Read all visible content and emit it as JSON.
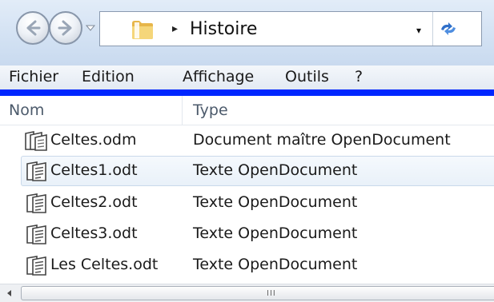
{
  "address": {
    "path_segment": "Histoire",
    "separator": "▸",
    "dropdown_glyph": "▾"
  },
  "menu": {
    "items": [
      "Fichier",
      "Edition",
      "Affichage",
      "Outils",
      "?"
    ]
  },
  "columns": {
    "name": "Nom",
    "type": "Type"
  },
  "files": [
    {
      "name": "Celtes.odm",
      "type": "Document maître OpenDocument",
      "icon": "odm-master-document-icon",
      "selected": false
    },
    {
      "name": "Celtes1.odt",
      "type": "Texte OpenDocument",
      "icon": "odt-text-document-icon",
      "selected": true
    },
    {
      "name": "Celtes2.odt",
      "type": "Texte OpenDocument",
      "icon": "odt-text-document-icon",
      "selected": false
    },
    {
      "name": "Celtes3.odt",
      "type": "Texte OpenDocument",
      "icon": "odt-text-document-icon",
      "selected": false
    },
    {
      "name": "Les Celtes.odt",
      "type": "Texte OpenDocument",
      "icon": "odt-text-document-icon",
      "selected": false
    }
  ],
  "scrollbar": {
    "grip": "III"
  },
  "colors": {
    "accent_bar": "#0026ff",
    "selection_bg": "#e9f1f9",
    "selection_border": "#c9d9ea",
    "header_text": "#4c5a6b"
  }
}
